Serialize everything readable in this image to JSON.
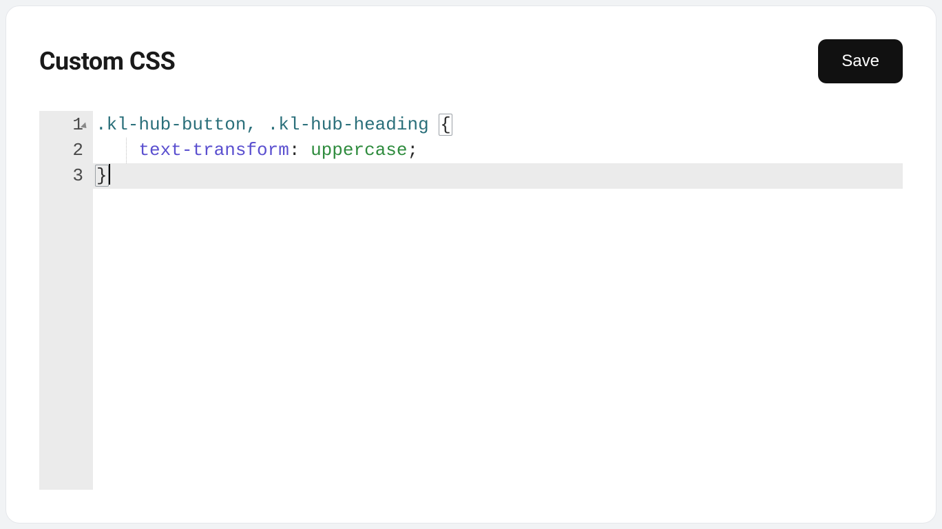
{
  "header": {
    "title": "Custom CSS",
    "save_label": "Save"
  },
  "editor": {
    "gutter": {
      "1": "1",
      "2": "2",
      "3": "3"
    },
    "lines": {
      "l1_selector": ".kl-hub-button, .kl-hub-heading ",
      "l1_brace": "{",
      "l2_indent": "    ",
      "l2_prop": "text-transform",
      "l2_colon": ": ",
      "l2_value": "uppercase",
      "l2_semi": ";",
      "l3_brace": "}"
    }
  }
}
